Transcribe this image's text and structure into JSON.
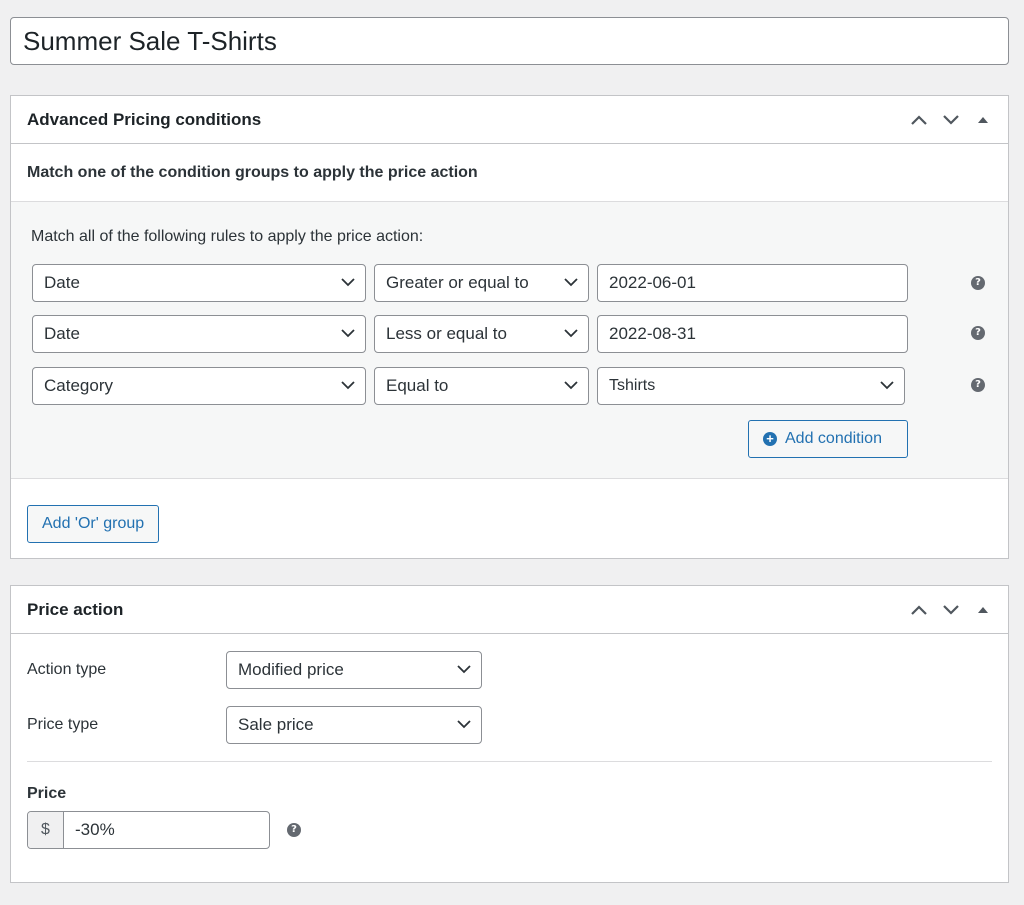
{
  "product_title": "Summer Sale T-Shirts",
  "conditions_box": {
    "title": "Advanced Pricing conditions",
    "subtitle": "Match one of the condition groups to apply the price action",
    "group": {
      "label": "Match all of the following rules to apply the price action:",
      "rules": [
        {
          "field": "Date",
          "operator": "Greater or equal to",
          "value": "2022-06-01",
          "value_kind": "text"
        },
        {
          "field": "Date",
          "operator": "Less or equal to",
          "value": "2022-08-31",
          "value_kind": "text"
        },
        {
          "field": "Category",
          "operator": "Equal to",
          "value": "Tshirts",
          "value_kind": "select"
        }
      ],
      "add_condition_label": "Add condition"
    },
    "add_or_group_label": "Add 'Or' group"
  },
  "price_action_box": {
    "title": "Price action",
    "action_type_label": "Action type",
    "action_type_value": "Modified price",
    "price_type_label": "Price type",
    "price_type_value": "Sale price",
    "price_label": "Price",
    "currency_symbol": "$",
    "price_value": "-30%"
  },
  "help_glyph": "?",
  "colors": {
    "accent": "#2271b1",
    "background": "#f0f0f1",
    "border": "#c3c4c7"
  }
}
